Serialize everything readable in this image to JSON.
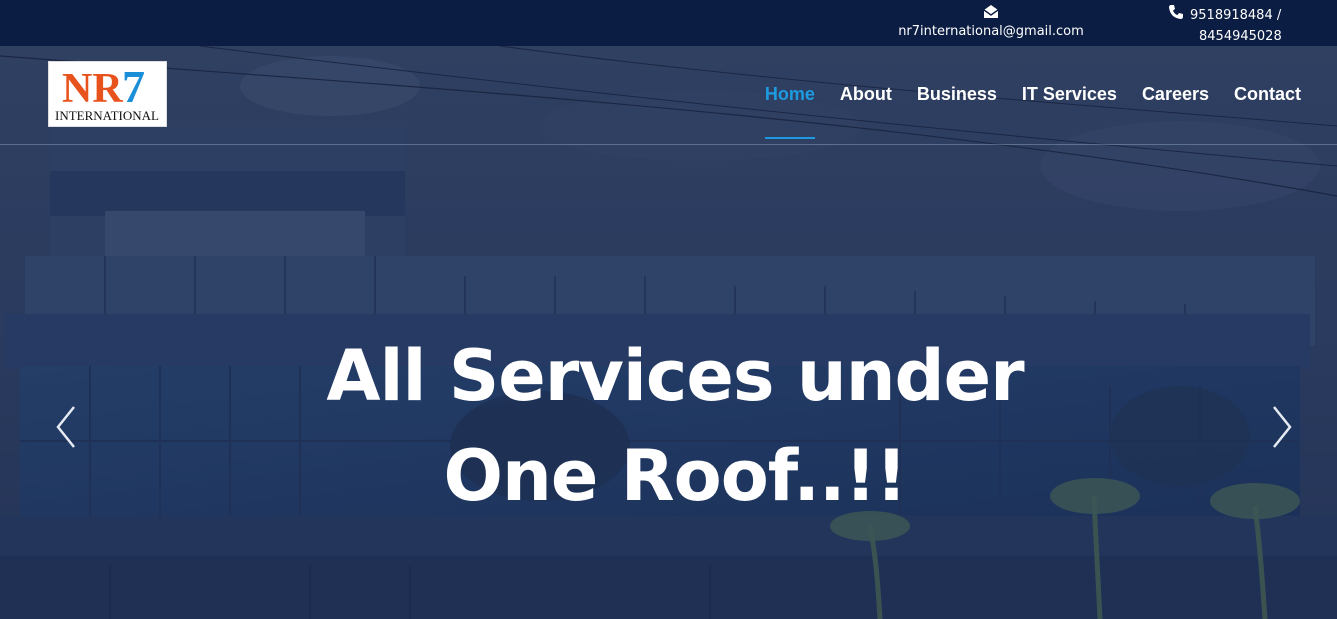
{
  "topbar": {
    "email": "nr7international@gmail.com",
    "email_icon": "envelope-icon",
    "phone_line1": "9518918484 /",
    "phone_line2": "8454945028",
    "phone_icon": "phone-icon",
    "background": "#0b1d42"
  },
  "logo": {
    "brand": "NR7",
    "subtitle": "INTERNATIONAL",
    "colors": {
      "n": "#e8531d",
      "r": "#e8531d",
      "seven": "#1a8fd8"
    }
  },
  "nav": {
    "items": [
      {
        "label": "Home",
        "active": true
      },
      {
        "label": "About",
        "active": false
      },
      {
        "label": "Business",
        "active": false
      },
      {
        "label": "IT Services",
        "active": false
      },
      {
        "label": "Careers",
        "active": false
      },
      {
        "label": "Contact",
        "active": false
      }
    ],
    "active_color": "#1e9be0"
  },
  "hero": {
    "headline_line1": "All Services under",
    "headline_line2": "One Roof..!!",
    "prev_icon": "chevron-left-icon",
    "next_icon": "chevron-right-icon"
  }
}
